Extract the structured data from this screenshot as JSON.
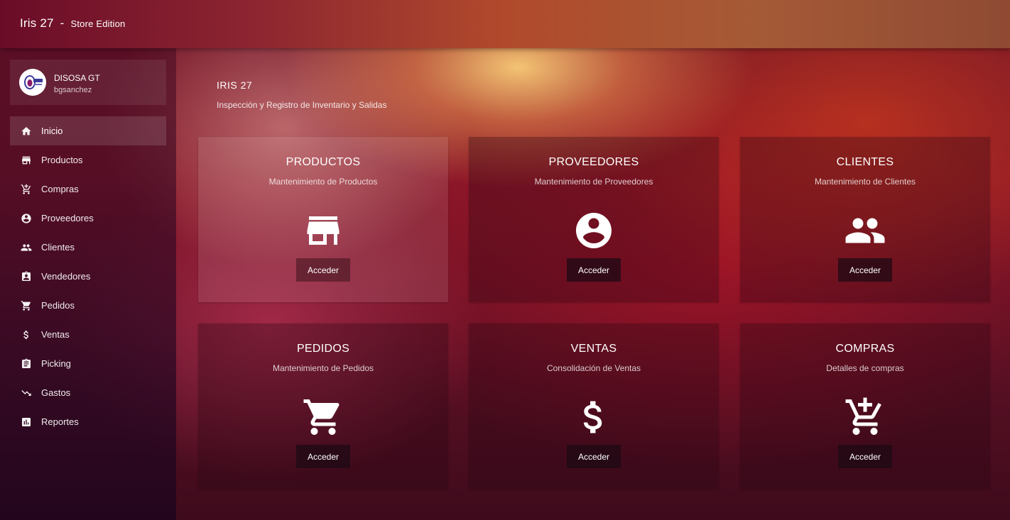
{
  "app": {
    "title": "Iris 27",
    "separator": "-",
    "edition": "Store Edition"
  },
  "profile": {
    "name": "DISOSA GT",
    "username": "bgsanchez"
  },
  "sidebar": {
    "items": [
      {
        "label": "Inicio",
        "icon": "home-icon",
        "active": true
      },
      {
        "label": "Productos",
        "icon": "store-icon"
      },
      {
        "label": "Compras",
        "icon": "add-shopping-cart-icon"
      },
      {
        "label": "Proveedores",
        "icon": "account-circle-icon"
      },
      {
        "label": "Clientes",
        "icon": "people-icon"
      },
      {
        "label": "Vendedores",
        "icon": "assignment-ind-icon"
      },
      {
        "label": "Pedidos",
        "icon": "shopping-cart-icon"
      },
      {
        "label": "Ventas",
        "icon": "dollar-icon"
      },
      {
        "label": "Picking",
        "icon": "assignment-icon"
      },
      {
        "label": "Gastos",
        "icon": "trending-down-icon"
      },
      {
        "label": "Reportes",
        "icon": "bar-chart-icon"
      }
    ]
  },
  "hero": {
    "title": "IRIS 27",
    "subtitle": "Inspección y Registro de Inventario y Salidas"
  },
  "cards": [
    {
      "title": "PRODUCTOS",
      "subtitle": "Mantenimiento de Productos",
      "icon": "store-icon",
      "button": "Acceder"
    },
    {
      "title": "PROVEEDORES",
      "subtitle": "Mantenimiento de Proveedores",
      "icon": "account-circle-icon",
      "button": "Acceder"
    },
    {
      "title": "CLIENTES",
      "subtitle": "Mantenimiento de Clientes",
      "icon": "people-icon",
      "button": "Acceder"
    },
    {
      "title": "PEDIDOS",
      "subtitle": "Mantenimiento de Pedidos",
      "icon": "shopping-cart-icon",
      "button": "Acceder"
    },
    {
      "title": "VENTAS",
      "subtitle": "Consolidación de Ventas",
      "icon": "dollar-icon",
      "button": "Acceder"
    },
    {
      "title": "COMPRAS",
      "subtitle": "Detalles de compras",
      "icon": "add-shopping-cart-icon",
      "button": "Acceder"
    }
  ]
}
